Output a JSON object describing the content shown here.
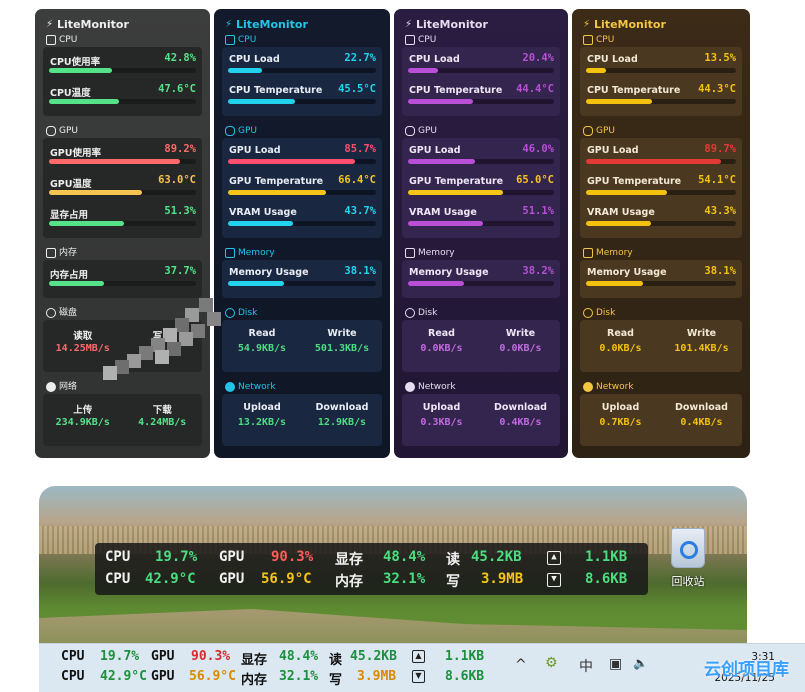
{
  "app_title": "LiteMonitor",
  "panels": [
    {
      "theme": "dark-gray",
      "sections": {
        "cpu": "CPU",
        "gpu": "GPU",
        "memory": "内存",
        "disk": "磁盘",
        "network": "网络"
      },
      "cpu": [
        {
          "label": "CPU使用率",
          "value": "42.8%",
          "pct": 42.8,
          "color": "#55e38a"
        },
        {
          "label": "CPU温度",
          "value": "47.6°C",
          "pct": 47.6,
          "color": "#55e38a"
        }
      ],
      "gpu": [
        {
          "label": "GPU使用率",
          "value": "89.2%",
          "pct": 89.2,
          "color": "#ff6b6b"
        },
        {
          "label": "GPU温度",
          "value": "63.0°C",
          "pct": 63.0,
          "color": "#f5c451"
        },
        {
          "label": "显存占用",
          "value": "51.3%",
          "pct": 51.3,
          "color": "#55e38a"
        }
      ],
      "memory": [
        {
          "label": "内存占用",
          "value": "37.7%",
          "pct": 37.7,
          "color": "#55e38a"
        }
      ],
      "disk": {
        "read_label": "读取",
        "write_label": "写入",
        "read": "14.25MB/s",
        "write": "",
        "read_color": "#ff6b6b",
        "write_color": "#ff6b6b"
      },
      "network": {
        "up_label": "上传",
        "down_label": "下载",
        "up": "234.9KB/s",
        "down": "4.24MB/s",
        "up_color": "#55e38a",
        "down_color": "#55e38a"
      }
    },
    {
      "theme": "navy",
      "sections": {
        "cpu": "CPU",
        "gpu": "GPU",
        "memory": "Memory",
        "disk": "Disk",
        "network": "Network"
      },
      "cpu": [
        {
          "label": "CPU Load",
          "value": "22.7%",
          "pct": 22.7,
          "color": "#22d3ee"
        },
        {
          "label": "CPU Temperature",
          "value": "45.5°C",
          "pct": 45.5,
          "color": "#22d3ee"
        }
      ],
      "gpu": [
        {
          "label": "GPU Load",
          "value": "85.7%",
          "pct": 85.7,
          "color": "#ff4d6d"
        },
        {
          "label": "GPU Temperature",
          "value": "66.4°C",
          "pct": 66.4,
          "color": "#f5c518"
        },
        {
          "label": "VRAM Usage",
          "value": "43.7%",
          "pct": 43.7,
          "color": "#22d3ee"
        }
      ],
      "memory": [
        {
          "label": "Memory Usage",
          "value": "38.1%",
          "pct": 38.1,
          "color": "#22d3ee"
        }
      ],
      "disk": {
        "read_label": "Read",
        "write_label": "Write",
        "read": "54.9KB/s",
        "write": "501.3KB/s",
        "read_color": "#4ade80",
        "write_color": "#4ade80"
      },
      "network": {
        "up_label": "Upload",
        "down_label": "Download",
        "up": "13.2KB/s",
        "down": "12.9KB/s",
        "up_color": "#4ade80",
        "down_color": "#4ade80"
      }
    },
    {
      "theme": "purple",
      "sections": {
        "cpu": "CPU",
        "gpu": "GPU",
        "memory": "Memory",
        "disk": "Disk",
        "network": "Network"
      },
      "cpu": [
        {
          "label": "CPU Load",
          "value": "20.4%",
          "pct": 20.4,
          "color": "#b84fd6"
        },
        {
          "label": "CPU Temperature",
          "value": "44.4°C",
          "pct": 44.4,
          "color": "#b84fd6"
        }
      ],
      "gpu": [
        {
          "label": "GPU Load",
          "value": "46.0%",
          "pct": 46.0,
          "color": "#b84fd6"
        },
        {
          "label": "GPU Temperature",
          "value": "65.0°C",
          "pct": 65.0,
          "color": "#f5c518"
        },
        {
          "label": "VRAM Usage",
          "value": "51.1%",
          "pct": 51.1,
          "color": "#b84fd6"
        }
      ],
      "memory": [
        {
          "label": "Memory Usage",
          "value": "38.2%",
          "pct": 38.2,
          "color": "#b84fd6"
        }
      ],
      "disk": {
        "read_label": "Read",
        "write_label": "Write",
        "read": "0.0KB/s",
        "write": "0.0KB/s",
        "read_color": "#c26be0",
        "write_color": "#c26be0"
      },
      "network": {
        "up_label": "Upload",
        "down_label": "Download",
        "up": "0.3KB/s",
        "down": "0.4KB/s",
        "up_color": "#c26be0",
        "down_color": "#c26be0"
      }
    },
    {
      "theme": "amber",
      "sections": {
        "cpu": "CPU",
        "gpu": "GPU",
        "memory": "Memory",
        "disk": "Disk",
        "network": "Network"
      },
      "cpu": [
        {
          "label": "CPU Load",
          "value": "13.5%",
          "pct": 13.5,
          "color": "#f4c20d"
        },
        {
          "label": "CPU Temperature",
          "value": "44.3°C",
          "pct": 44.3,
          "color": "#f4c20d"
        }
      ],
      "gpu": [
        {
          "label": "GPU Load",
          "value": "89.7%",
          "pct": 89.7,
          "color": "#e53935"
        },
        {
          "label": "GPU Temperature",
          "value": "54.1°C",
          "pct": 54.1,
          "color": "#f4c20d"
        },
        {
          "label": "VRAM Usage",
          "value": "43.3%",
          "pct": 43.3,
          "color": "#f4c20d"
        }
      ],
      "memory": [
        {
          "label": "Memory Usage",
          "value": "38.1%",
          "pct": 38.1,
          "color": "#f4c20d"
        }
      ],
      "disk": {
        "read_label": "Read",
        "write_label": "Write",
        "read": "0.0KB/s",
        "write": "101.4KB/s",
        "read_color": "#f4c20d",
        "write_color": "#f4c20d"
      },
      "network": {
        "up_label": "Upload",
        "down_label": "Download",
        "up": "0.7KB/s",
        "down": "0.4KB/s",
        "up_color": "#f4c20d",
        "down_color": "#f4c20d"
      }
    }
  ],
  "overlay": {
    "row1": {
      "cpu_label": "CPU",
      "cpu": "19.7%",
      "gpu_label": "GPU",
      "gpu": "90.3%",
      "vram_label": "显存",
      "vram": "48.4%",
      "read_label": "读",
      "read": "45.2KB",
      "up": "1.1KB"
    },
    "row2": {
      "cpu_label": "CPU",
      "cpu": "42.9°C",
      "gpu_label": "GPU",
      "gpu": "56.9°C",
      "mem_label": "内存",
      "mem": "32.1%",
      "write_label": "写",
      "write": "3.9MB",
      "down": "8.6KB"
    }
  },
  "desktop": {
    "recycle_bin_label": "回收站"
  },
  "taskbar": {
    "row1": {
      "cpu_label": "CPU",
      "cpu": "19.7%",
      "gpu_label": "GPU",
      "gpu": "90.3%",
      "vram_label": "显存",
      "vram": "48.4%",
      "read_label": "读",
      "read": "45.2KB",
      "up": "1.1KB"
    },
    "row2": {
      "cpu_label": "CPU",
      "cpu": "42.9°C",
      "gpu_label": "GPU",
      "gpu": "56.9°C",
      "mem_label": "内存",
      "mem": "32.1%",
      "write_label": "写",
      "write": "3.9MB",
      "down": "8.6KB"
    },
    "ime": "中",
    "time": "3:31",
    "date": "2025/11/25"
  },
  "watermark": "云创项目库"
}
